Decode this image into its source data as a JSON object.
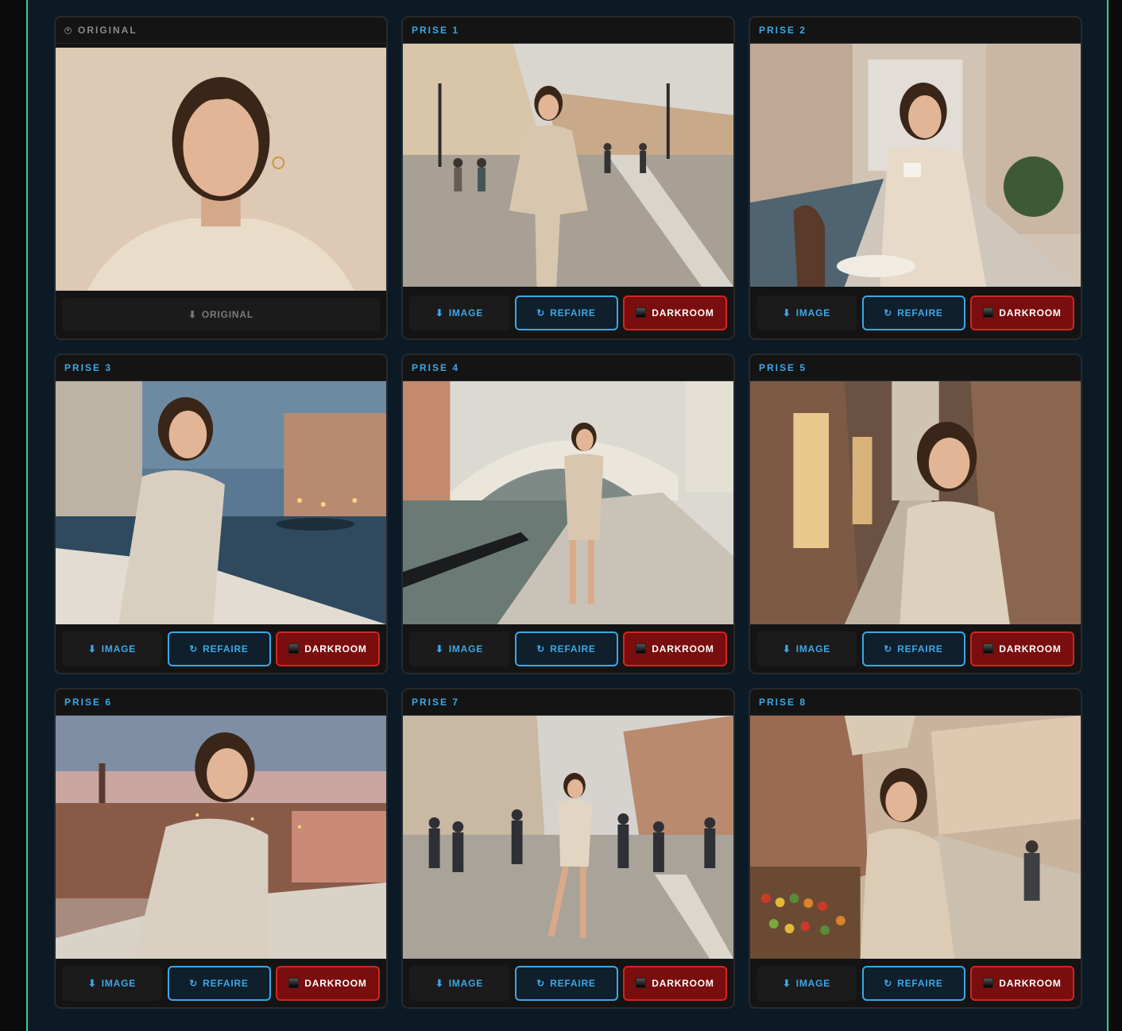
{
  "original": {
    "title": "ORIGINAL",
    "download_label": "ORIGINAL",
    "download_icon": "download-arrow-icon"
  },
  "buttons": {
    "image_label": "IMAGE",
    "redo_label": "REFAIRE",
    "darkroom_label": "DARKROOM",
    "image_icon": "⬇",
    "redo_icon": "↻"
  },
  "shots": [
    {
      "title": "PRISE 1"
    },
    {
      "title": "PRISE 2"
    },
    {
      "title": "PRISE 3"
    },
    {
      "title": "PRISE 4"
    },
    {
      "title": "PRISE 5"
    },
    {
      "title": "PRISE 6"
    },
    {
      "title": "PRISE 7"
    },
    {
      "title": "PRISE 8"
    }
  ],
  "colors": {
    "accent": "#3aa8e8",
    "danger": "#d02626",
    "frame": "#2fd08a",
    "background": "#0c1a26"
  }
}
